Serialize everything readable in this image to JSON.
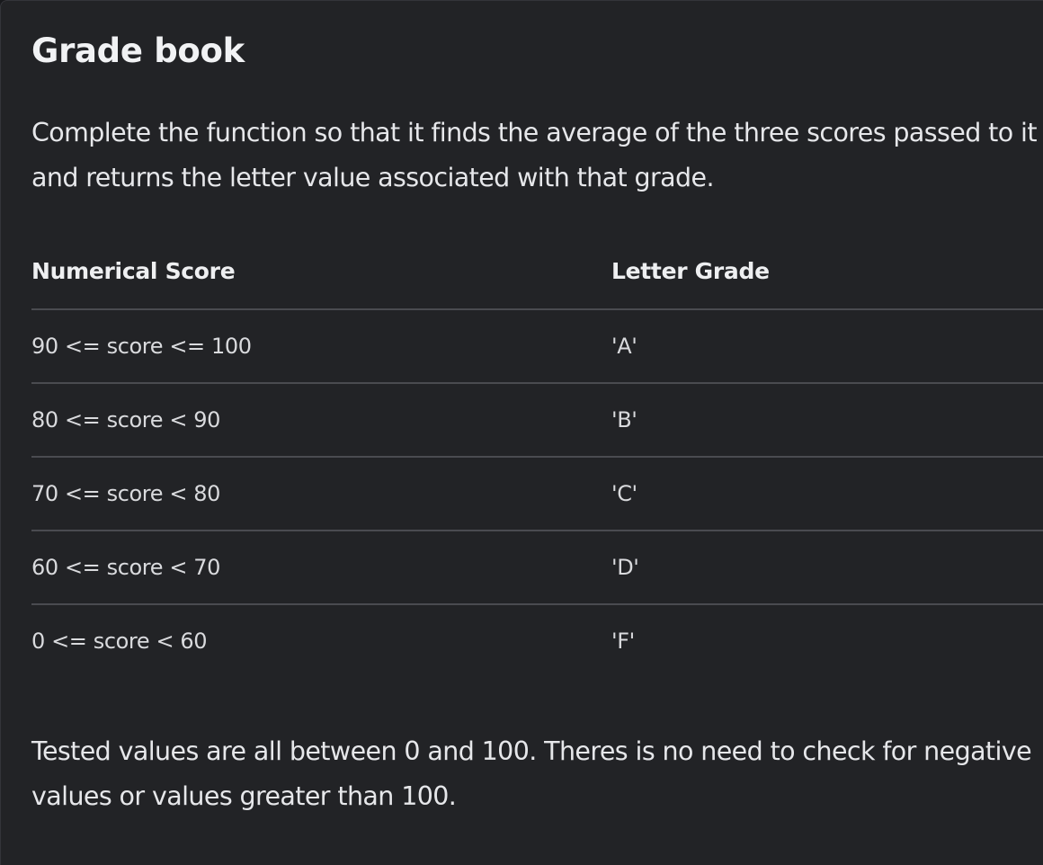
{
  "title": "Grade book",
  "intro": {
    "line1": "Complete the function so that it finds the average of the three scores passed to it",
    "line2": "and returns the letter value associated with that grade."
  },
  "table": {
    "headers": [
      "Numerical Score",
      "Letter Grade"
    ],
    "rows": [
      [
        "90 <= score <= 100",
        "'A'"
      ],
      [
        "80 <= score < 90",
        "'B'"
      ],
      [
        "70 <= score < 80",
        "'C'"
      ],
      [
        "60 <= score < 70",
        "'D'"
      ],
      [
        "0 <= score < 60",
        "'F'"
      ]
    ]
  },
  "note": {
    "line1": "Tested values are all between 0 and 100. Theres is no need to check for negative",
    "line2": "values or values greater than 100."
  }
}
